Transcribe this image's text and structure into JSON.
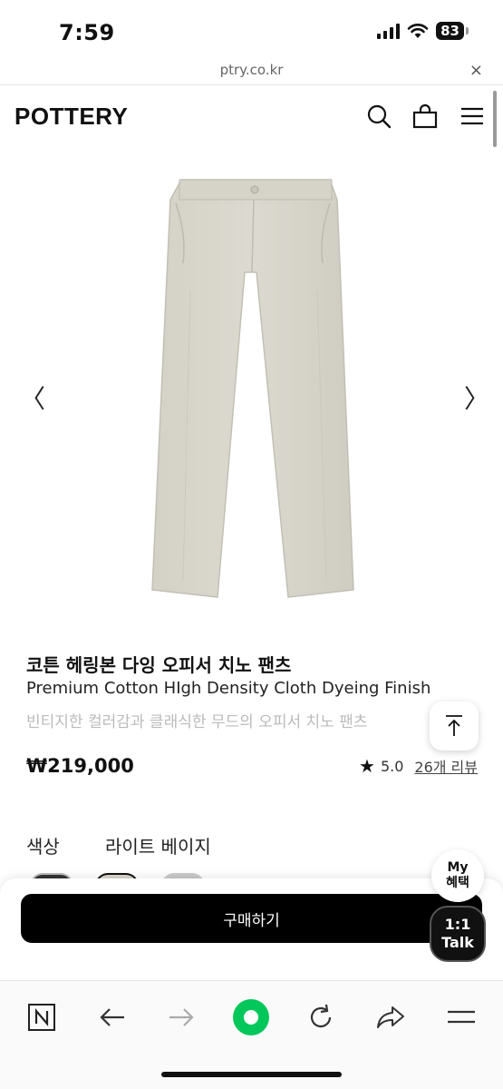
{
  "status_bar": {
    "time": "7:59",
    "battery": "83"
  },
  "url_bar": {
    "url": "ptry.co.kr",
    "close": "×"
  },
  "header": {
    "logo": "POTTERY"
  },
  "carousel": {
    "prev": "〈",
    "next": "〉"
  },
  "product": {
    "title_ko": "코튼 헤링본 다잉 오피서 치노 팬츠",
    "title_en": "Premium Cotton HIgh Density Cloth Dyeing Finish",
    "description": "빈티지한 컬러감과 클래식한 무드의 오피서 치노 팬츠",
    "price": "₩219,000",
    "rating": "5.0",
    "reviews": "26개 리뷰",
    "color_label": "색상",
    "color_value": "라이트 베이지"
  },
  "floating": {
    "my_benefit_line1": "My",
    "my_benefit_line2": "혜택",
    "talk_line1": "1:1",
    "talk_line2": "Talk"
  },
  "purchase": {
    "buy_label": "구매하기"
  },
  "colors": {
    "accent": "#000000",
    "toolbar_green": "#03c75a",
    "swatches": [
      "#333333",
      "#d9d6cc",
      "#c8c8c8"
    ]
  }
}
